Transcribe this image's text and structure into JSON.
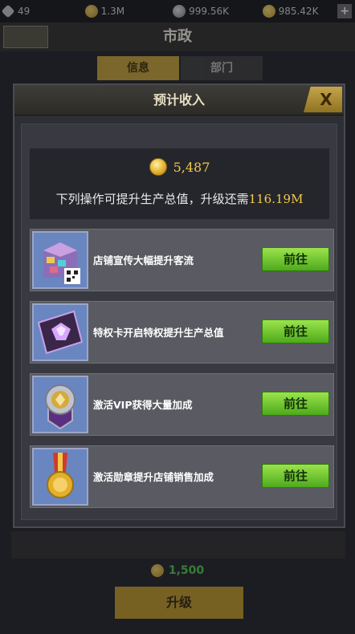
{
  "resources": [
    {
      "icon": "diamond-icon",
      "value": "49"
    },
    {
      "icon": "coin-icon",
      "value": "1.3M"
    },
    {
      "icon": "silver-icon",
      "value": "999.56K"
    },
    {
      "icon": "gold-icon",
      "value": "985.42K"
    }
  ],
  "background": {
    "title": "市政",
    "tabs": [
      "信息",
      "部门"
    ],
    "cost": "1,500",
    "upgrade_label": "升级"
  },
  "modal": {
    "title": "预计收入",
    "close_label": "X",
    "gold": "5,487",
    "need_label": "下列操作可提升生产总值，升级还需",
    "need_value": "116.19M",
    "tasks": [
      {
        "icon": "shop-building-icon",
        "label": "店铺宣传大幅提升客流",
        "button": "前往"
      },
      {
        "icon": "privilege-card-icon",
        "label": "特权卡开启特权提升生产总值",
        "button": "前往"
      },
      {
        "icon": "vip-badge-icon",
        "label": "激活VIP获得大量加成",
        "button": "前往"
      },
      {
        "icon": "medal-icon",
        "label": "激活勋章提升店铺销售加成",
        "button": "前往"
      }
    ]
  },
  "colors": {
    "accent_gold": "#f4c84a",
    "button_green": "#6cc531",
    "modal_bg": "#383941"
  }
}
